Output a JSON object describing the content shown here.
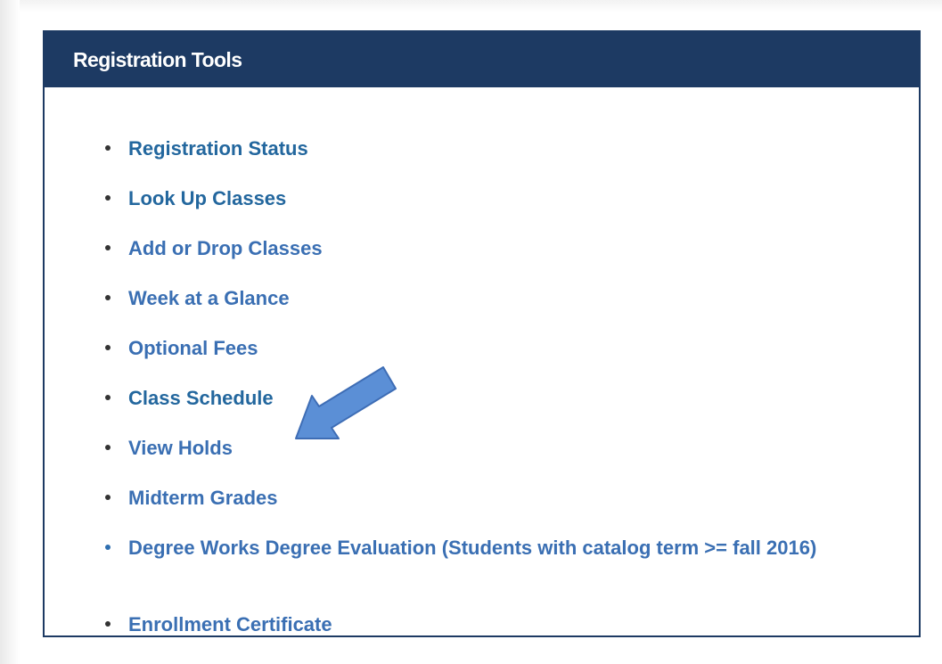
{
  "panel": {
    "title": "Registration Tools"
  },
  "tools": [
    {
      "label": "Registration Status"
    },
    {
      "label": "Look Up Classes"
    },
    {
      "label": "Add or Drop Classes"
    },
    {
      "label": "Week at a Glance"
    },
    {
      "label": "Optional Fees"
    },
    {
      "label": "Class Schedule"
    },
    {
      "label": "View Holds"
    },
    {
      "label": "Midterm Grades"
    },
    {
      "label": "Degree Works Degree Evaluation (Students with catalog term >= fall 2016)"
    },
    {
      "label": "Enrollment Certificate"
    }
  ],
  "colors": {
    "header_bg": "#1d3a63",
    "link": "#3a6fb3",
    "link_visited": "#23679e",
    "arrow_fill": "#5b8fd6",
    "arrow_stroke": "#3e6db5"
  },
  "annotation": {
    "icon": "pointer-arrow-icon"
  }
}
